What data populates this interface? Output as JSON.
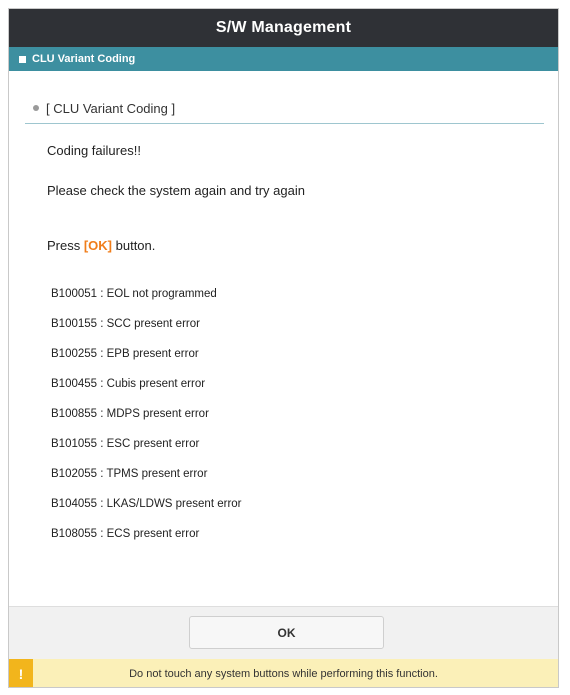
{
  "window": {
    "title": "S/W Management"
  },
  "subheader": {
    "label": "CLU Variant Coding"
  },
  "section": {
    "heading": "[ CLU Variant Coding ]"
  },
  "messages": {
    "line1": "Coding failures!!",
    "line2": "Please check the system again and try again",
    "press_prefix": "Press ",
    "press_ok": "[OK]",
    "press_suffix": " button."
  },
  "codes": [
    {
      "code": "B100051",
      "sep": " : ",
      "desc": "EOL not programmed"
    },
    {
      "code": "B100155",
      "sep": " : ",
      "desc": "SCC present error"
    },
    {
      "code": "B100255",
      "sep": " : ",
      "desc": "EPB present error"
    },
    {
      "code": "B100455",
      "sep": " : ",
      "desc": "Cubis present error"
    },
    {
      "code": "B100855",
      "sep": " : ",
      "desc": "MDPS present error"
    },
    {
      "code": "B101055",
      "sep": " : ",
      "desc": "ESC present error"
    },
    {
      "code": "B102055",
      "sep": " : ",
      "desc": "TPMS present error"
    },
    {
      "code": "B104055",
      "sep": " : ",
      "desc": "LKAS/LDWS present error"
    },
    {
      "code": "B108055",
      "sep": " : ",
      "desc": "ECS present error"
    }
  ],
  "footer": {
    "ok_label": "OK"
  },
  "warning": {
    "icon": "!",
    "icon_name": "warning-icon",
    "text": "Do not touch any system buttons while performing this function."
  },
  "colors": {
    "titlebar": "#2f3136",
    "subbar": "#3d8fa0",
    "ok_highlight": "#f07d1a",
    "warning_bg": "#fbf0b8",
    "warning_icon": "#f2b51c"
  }
}
